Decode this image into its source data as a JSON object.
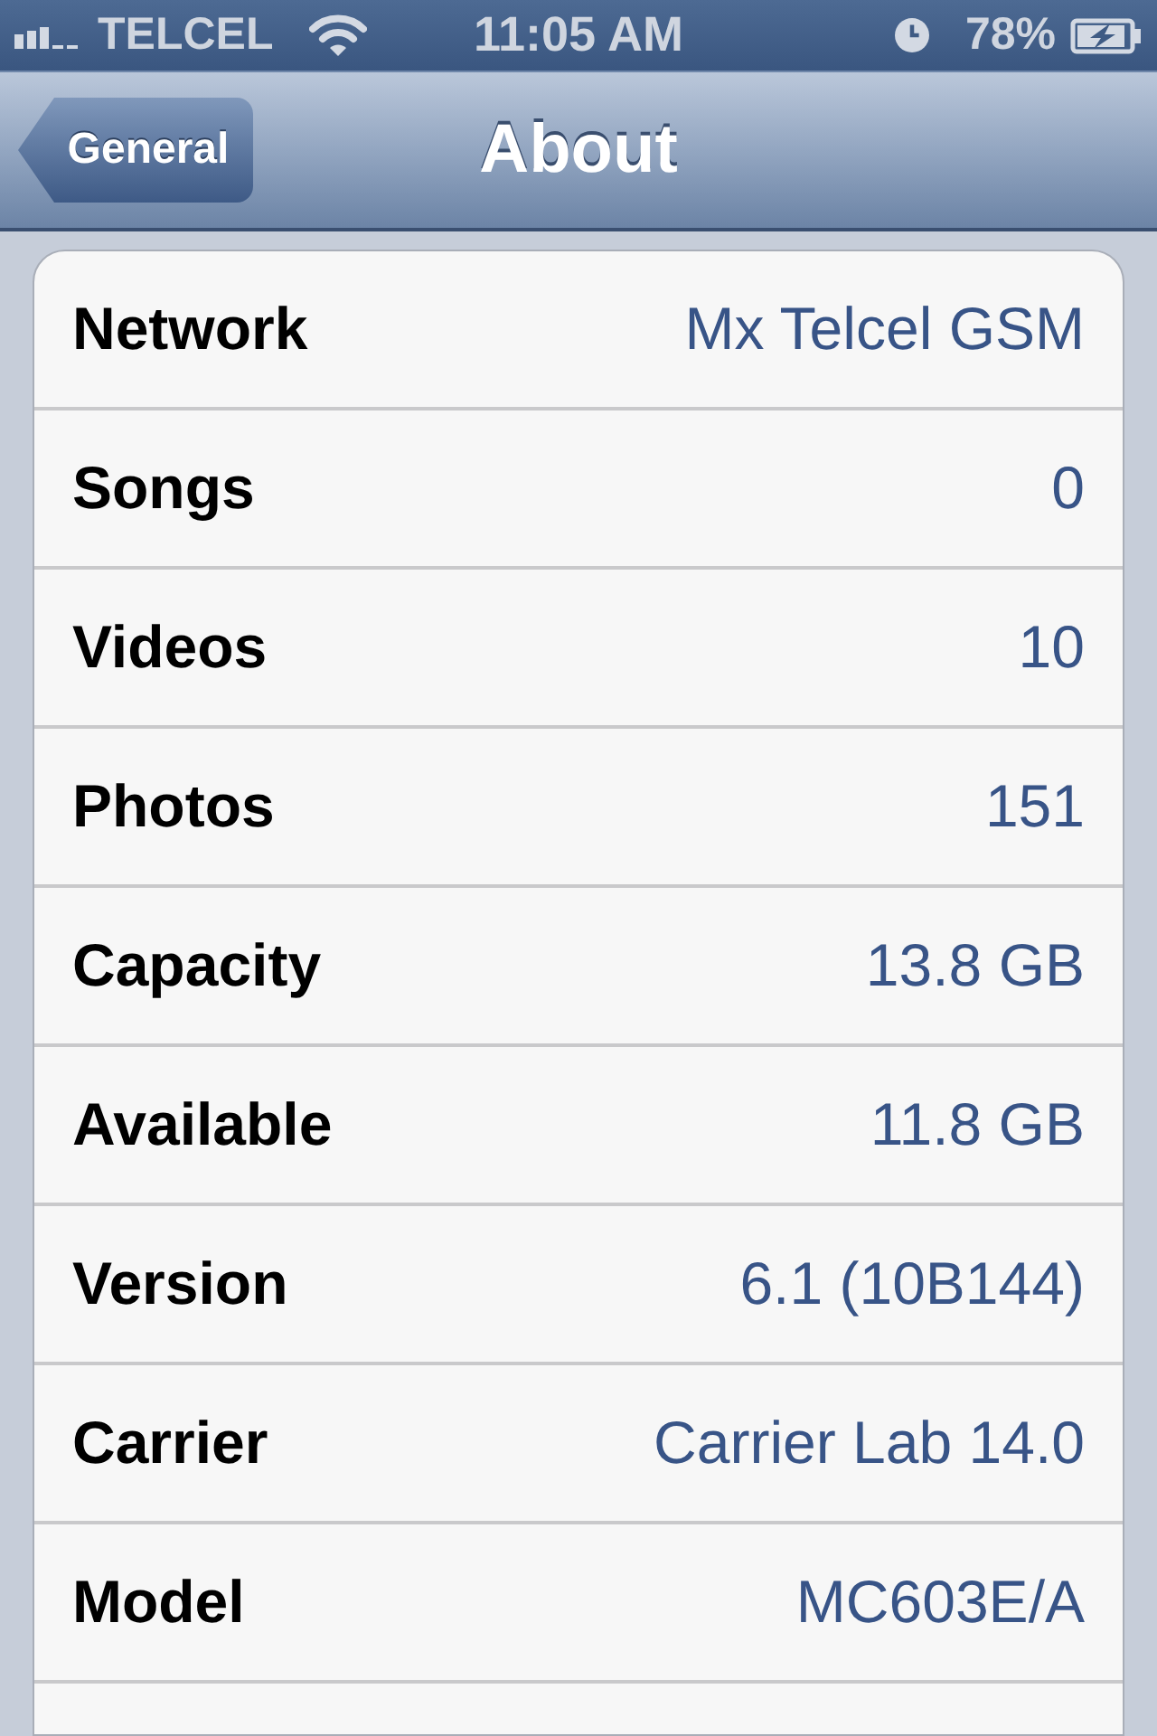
{
  "status_bar": {
    "carrier": "TELCEL",
    "time": "11:05 AM",
    "battery": "78%"
  },
  "nav_bar": {
    "back_button": "General",
    "title": "About"
  },
  "rows": [
    {
      "label": "Network",
      "value": "Mx Telcel GSM"
    },
    {
      "label": "Songs",
      "value": "0"
    },
    {
      "label": "Videos",
      "value": "10"
    },
    {
      "label": "Photos",
      "value": "151"
    },
    {
      "label": "Capacity",
      "value": "13.8 GB"
    },
    {
      "label": "Available",
      "value": "11.8 GB"
    },
    {
      "label": "Version",
      "value": "6.1 (10B144)"
    },
    {
      "label": "Carrier",
      "value": "Carrier Lab 14.0"
    },
    {
      "label": "Model",
      "value": "MC603E/A"
    }
  ]
}
